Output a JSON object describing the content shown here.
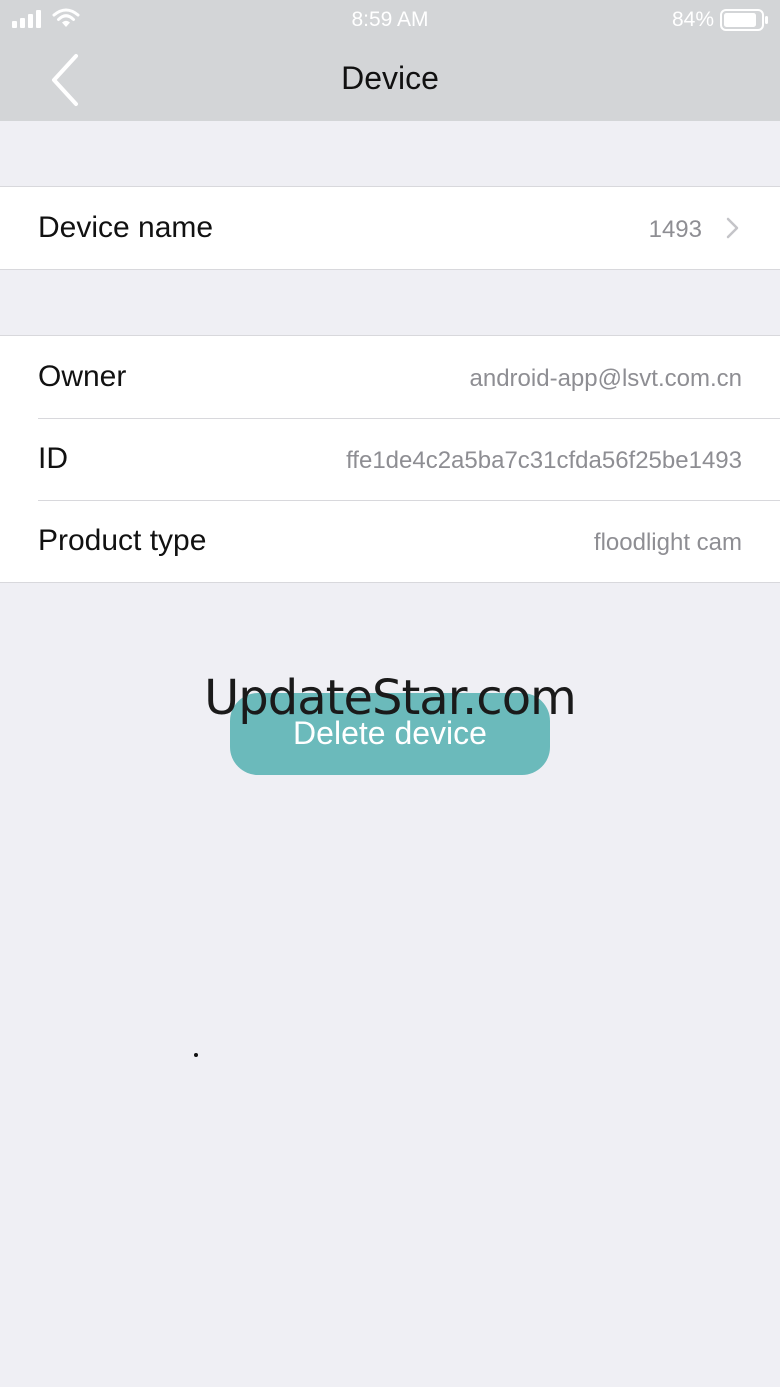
{
  "status_bar": {
    "time": "8:59 AM",
    "battery": "84%",
    "icons": [
      "signal-icon",
      "wifi-icon",
      "battery-icon"
    ]
  },
  "nav": {
    "title": "Device",
    "back_icon": "chevron-left-icon"
  },
  "device_name_row": {
    "label": "Device name",
    "value": "1493",
    "icon": "chevron-right-icon"
  },
  "info_rows": [
    {
      "label": "Owner",
      "value": "android-app@lsvt.com.cn"
    },
    {
      "label": "ID",
      "value": "ffe1de4c2a5ba7c31cfda56f25be1493"
    },
    {
      "label": "Product type",
      "value": "floodlight cam"
    }
  ],
  "delete_button": {
    "label": "Delete device",
    "color": "#6bbabb"
  },
  "watermark": "UpdateStar.com",
  "colors": {
    "nav_background": "#d3d5d7",
    "page_background": "#efeff4",
    "value_text": "#8e8e93"
  }
}
